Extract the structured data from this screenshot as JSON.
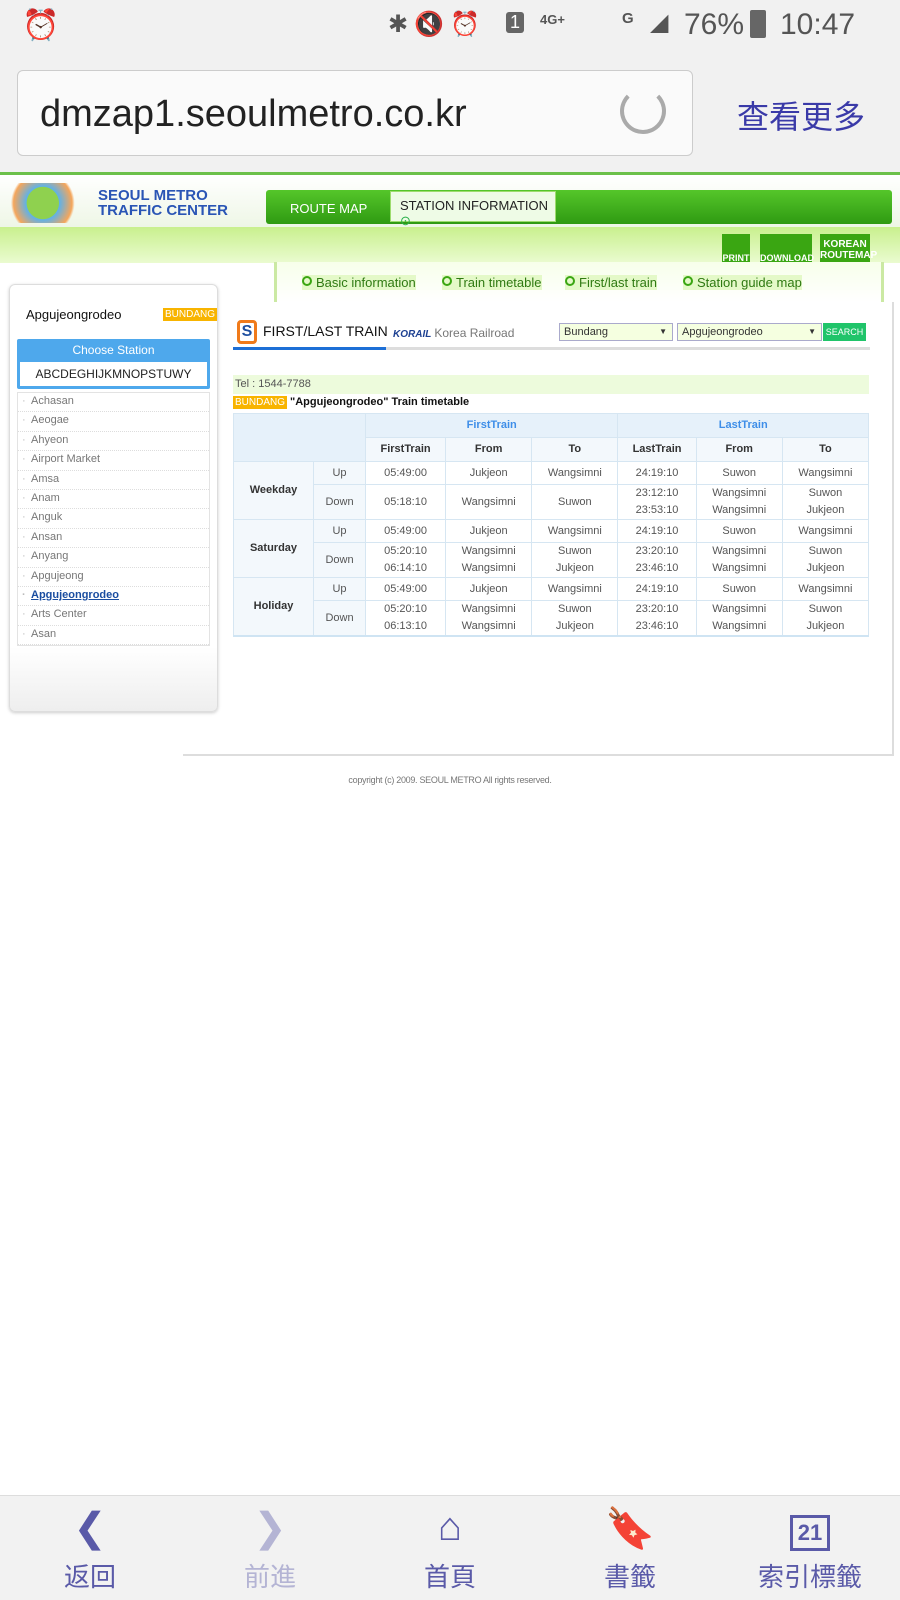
{
  "status_bar": {
    "battery": "76%",
    "time": "10:47",
    "network": "4G+",
    "network2": "G",
    "sim": "1"
  },
  "browser": {
    "url": "dmzap1.seoulmetro.co.kr",
    "more": "查看更多"
  },
  "site": {
    "logo_line1": "SEOUL METRO",
    "logo_line2": "TRAFFIC CENTER",
    "nav": [
      "ROUTE MAP",
      "STATION INFORMATION"
    ],
    "tools": [
      "PRINT",
      "DOWNLOAD",
      "KOREAN ROUTEMAP"
    ],
    "submenu": [
      "Basic information",
      "Train timetable",
      "First/last train",
      "Station guide map"
    ]
  },
  "sidebar": {
    "station": "Apgujeongrodeo",
    "line_badge": "BUNDANG",
    "choose_label": "Choose Station",
    "alphabet": "ABCDEGHIJKMNOPSTUWY",
    "stations": [
      "Achasan",
      "Aeogae",
      "Ahyeon",
      "Airport Market",
      "Amsa",
      "Anam",
      "Anguk",
      "Ansan",
      "Anyang",
      "Apgujeong",
      "Apgujeongrodeo",
      "Arts Center",
      "Asan"
    ],
    "active": "Apgujeongrodeo"
  },
  "content": {
    "title": "FIRST/LAST TRAIN",
    "korail_logo": "KORAIL",
    "korail_text": "Korea Railroad",
    "line_select": "Bundang",
    "station_select": "Apgujeongrodeo",
    "search": "SEARCH",
    "tel": "Tel : 1544-7788",
    "badge": "BUNDANG",
    "timetable_title": "\"Apgujeongrodeo\" Train timetable"
  },
  "table": {
    "groups": [
      "FirstTrain",
      "LastTrain"
    ],
    "columns": [
      "FirstTrain",
      "From",
      "To",
      "LastTrain",
      "From",
      "To"
    ],
    "days": [
      {
        "day": "Weekday",
        "rows": [
          {
            "dir": "Up",
            "cells": [
              "05:49:00",
              "Jukjeon",
              "Wangsimni",
              "24:19:10",
              "Suwon",
              "Wangsimni"
            ]
          },
          {
            "dir": "Down",
            "cells": [
              "05:18:10",
              "Wangsimni",
              "Suwon",
              "23:12:10\n23:53:10",
              "Wangsimni\nWangsimni",
              "Suwon\nJukjeon"
            ]
          }
        ]
      },
      {
        "day": "Saturday",
        "rows": [
          {
            "dir": "Up",
            "cells": [
              "05:49:00",
              "Jukjeon",
              "Wangsimni",
              "24:19:10",
              "Suwon",
              "Wangsimni"
            ]
          },
          {
            "dir": "Down",
            "cells": [
              "05:20:10\n06:14:10",
              "Wangsimni\nWangsimni",
              "Suwon\nJukjeon",
              "23:20:10\n23:46:10",
              "Wangsimni\nWangsimni",
              "Suwon\nJukjeon"
            ]
          }
        ]
      },
      {
        "day": "Holiday",
        "rows": [
          {
            "dir": "Up",
            "cells": [
              "05:49:00",
              "Jukjeon",
              "Wangsimni",
              "24:19:10",
              "Suwon",
              "Wangsimni"
            ]
          },
          {
            "dir": "Down",
            "cells": [
              "05:20:10\n06:13:10",
              "Wangsimni\nWangsimni",
              "Suwon\nJukjeon",
              "23:20:10\n23:46:10",
              "Wangsimni\nWangsimni",
              "Suwon\nJukjeon"
            ]
          }
        ]
      }
    ]
  },
  "copyright": "copyright (c) 2009. SEOUL METRO All rights reserved.",
  "bottom_nav": [
    {
      "label": "返回",
      "icon": "back-icon"
    },
    {
      "label": "前進",
      "icon": "forward-icon"
    },
    {
      "label": "首頁",
      "icon": "home-icon"
    },
    {
      "label": "書籤",
      "icon": "bookmark-icon"
    },
    {
      "label": "索引標籤",
      "icon": "tabs-icon",
      "count": "21"
    }
  ]
}
